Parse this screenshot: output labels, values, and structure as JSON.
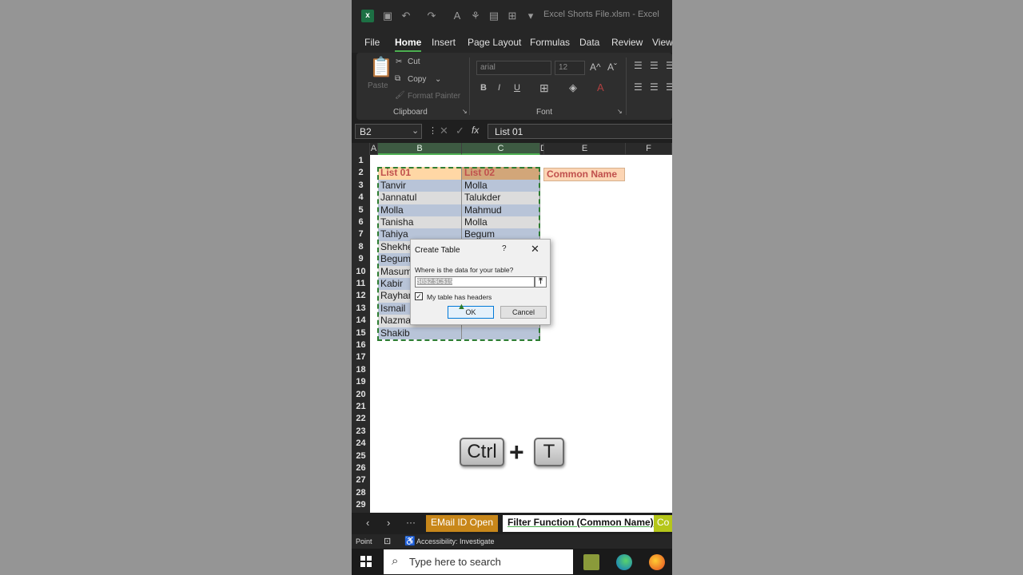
{
  "app": {
    "title": "Excel Shorts File.xlsm  -  Excel",
    "menu": [
      "File",
      "Home",
      "Insert",
      "Page Layout",
      "Formulas",
      "Data",
      "Review",
      "View"
    ],
    "active_menu": "Home"
  },
  "ribbon": {
    "clipboard": {
      "paste": "Paste",
      "cut": "Cut",
      "copy": "Copy",
      "format_painter": "Format Painter",
      "group": "Clipboard"
    },
    "font": {
      "family": "arial",
      "size": "12",
      "group": "Font",
      "bold": "B",
      "italic": "I",
      "underline": "U",
      "grow": "A^",
      "shrink": "Aˇ"
    }
  },
  "formula_bar": {
    "name_box": "B2",
    "fx": "fx",
    "content": "List 01"
  },
  "columns": [
    "A",
    "B",
    "C",
    "D",
    "E",
    "F"
  ],
  "rows": [
    "1",
    "2",
    "3",
    "4",
    "5",
    "6",
    "7",
    "8",
    "9",
    "10",
    "11",
    "12",
    "13",
    "14",
    "15",
    "16",
    "17",
    "18",
    "19",
    "20",
    "21",
    "22",
    "23",
    "24",
    "25",
    "26",
    "27",
    "28",
    "29"
  ],
  "table": {
    "headers": [
      "List 01",
      "List 02"
    ],
    "col_b": [
      "Tanvir",
      "Jannatul",
      "Molla",
      "Tanisha",
      "Tahiya",
      "Shekhe",
      "Begum",
      "Masum",
      "Kabir",
      "Rayhan",
      "Ismail",
      "Nazma",
      "Shakib"
    ],
    "col_c": [
      "Molla",
      "Talukder",
      "Mahmud",
      "Molla",
      "Begum",
      "",
      "",
      "",
      "",
      "",
      "",
      "",
      ""
    ]
  },
  "common_name": "Common Name",
  "dialog": {
    "title": "Create Table",
    "help": "?",
    "close": "✕",
    "prompt": "Where is the data for your table?",
    "range": "$B$2:$C$15",
    "checkbox_label": "My table has headers",
    "checkbox_checked": "✓",
    "ok": "OK",
    "cancel": "Cancel"
  },
  "shortcut": {
    "key1": "Ctrl",
    "plus": "+",
    "key2": "T"
  },
  "sheet_tabs": {
    "more": "···",
    "tab1": "EMail ID Open",
    "tab2": "Filter Function (Common Name)",
    "tab3": "Co"
  },
  "status": {
    "mode": "Point",
    "accessibility": "Accessibility: Investigate"
  },
  "taskbar": {
    "search_placeholder": "Type here to search"
  },
  "colors": {
    "header_fill": "#ffd7a5",
    "header_fill2": "#d2a679",
    "stripe1": "#b8c4d8",
    "stripe2": "#dcdcdc",
    "accent": "#4caf50",
    "tab1": "#c8871a",
    "tab3": "#b5c61a"
  }
}
